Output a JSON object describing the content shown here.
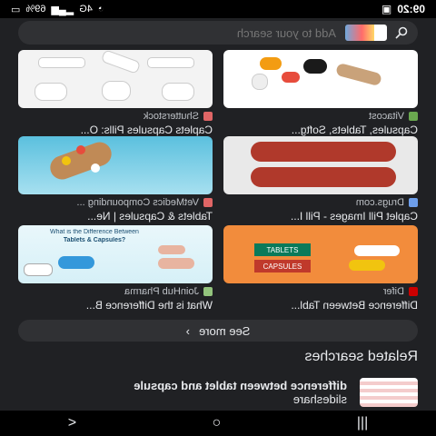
{
  "status": {
    "time": "09:20",
    "battery": "69%",
    "signal": "4G"
  },
  "search": {
    "placeholder": "Add to your search"
  },
  "results": [
    {
      "source": "Vitacost",
      "title": "Capsules, Tablets, Softg...",
      "fav": "#6aa84f"
    },
    {
      "source": "Shutterstock",
      "title": "Caplets Capsules Pills: O...",
      "fav": "#e06666"
    },
    {
      "source": "Drugs.com",
      "title": "Caplet Pill Images - Pill I...",
      "fav": "#6d9eeb"
    },
    {
      "source": "VetMedics Compounding ...",
      "title": "Tablets & Capsules | Ne...",
      "fav": "#e06666"
    },
    {
      "source": "Difer",
      "title": "Difference Between Tabl...",
      "fav": "#cc0000"
    },
    {
      "source": "JoinHub Pharma",
      "title": "What is the Difference B...",
      "fav": "#93c47d"
    }
  ],
  "img_text": {
    "tablets": "TABLETS",
    "capsules": "CAPSULES",
    "diff_q1": "What is the Difference Between",
    "diff_q2": "Tablets & Capsules?"
  },
  "see_more": {
    "label": "See more"
  },
  "related": {
    "heading": "Related searches",
    "items": [
      {
        "text_line1": "difference between tablet and capsule",
        "text_line2": "slideshare"
      }
    ]
  },
  "nav": {
    "recent": "|||",
    "home": "○",
    "back": "<"
  }
}
